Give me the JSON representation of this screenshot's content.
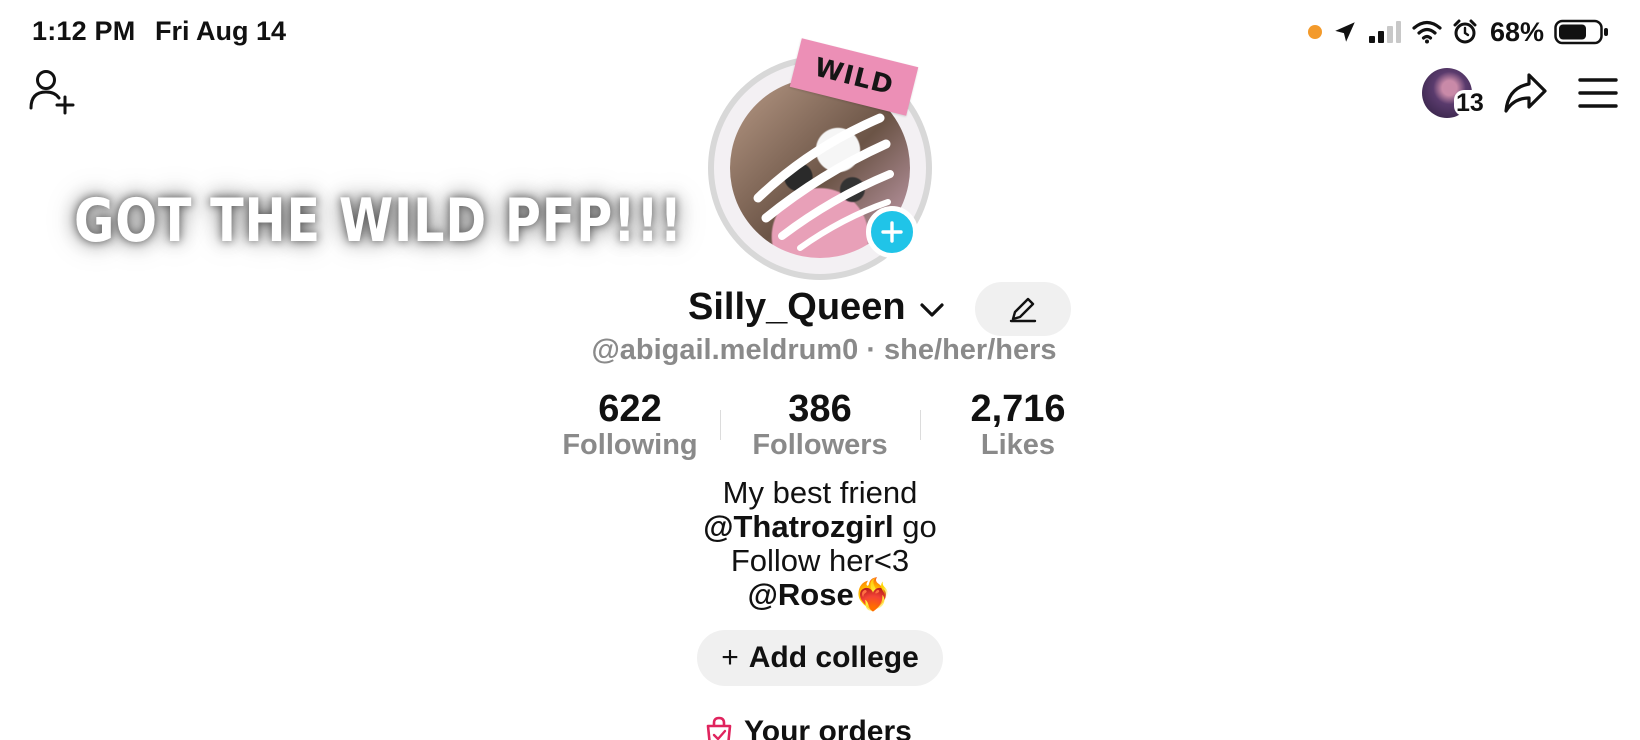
{
  "status_bar": {
    "time": "1:12 PM",
    "date": "Fri Aug 14",
    "battery_percent": "68%",
    "battery_level": 0.68,
    "indicator_color": "#f39a2b"
  },
  "header": {
    "add_friend_icon": "person-add-icon",
    "notification_count": "13",
    "share_icon": "share-arrow-icon",
    "menu_icon": "hamburger-menu-icon"
  },
  "overlay": {
    "caption": "GOT THE WILD PFP!!!"
  },
  "profile": {
    "sticker_text": "WILD",
    "username": "Silly_Queen",
    "handle": "@abigail.meldrum0",
    "pronouns": "she/her/hers",
    "handle_separator": " · ",
    "accent_color": "#20c4e8"
  },
  "stats": [
    {
      "value": "622",
      "label": "Following"
    },
    {
      "value": "386",
      "label": "Followers"
    },
    {
      "value": "2,716",
      "label": "Likes"
    }
  ],
  "bio": {
    "line1": "My best friend",
    "line2_mention": "@Thatrozgirl",
    "line2_rest": " go",
    "line3": "Follow her<3",
    "line4_mention": "@Rose",
    "line4_emoji": "❤️‍🔥"
  },
  "actions": {
    "add_college_plus": "+",
    "add_college": "Add college",
    "orders": "Your orders",
    "orders_icon_color": "#e0245e"
  }
}
